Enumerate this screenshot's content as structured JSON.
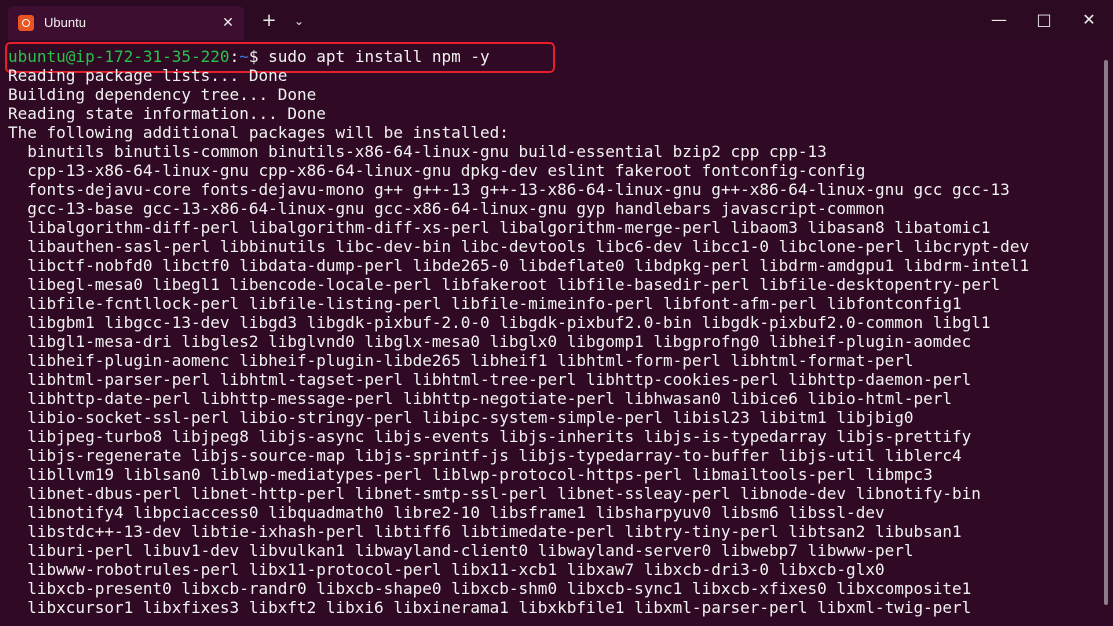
{
  "tab": {
    "title": "Ubuntu",
    "icon": "ubuntu-icon",
    "close_icon": "close-icon"
  },
  "titlebar": {
    "new_tab_icon": "plus-icon",
    "dropdown_icon": "chevron-down-icon",
    "minimize_icon": "minimize-icon",
    "maximize_icon": "maximize-icon",
    "close_icon": "close-icon"
  },
  "prompt": {
    "user_host": "ubuntu@ip-172-31-35-220",
    "separator": ":",
    "directory": "~",
    "symbol": "$",
    "command": " sudo apt install npm -y"
  },
  "output": [
    "Reading package lists... Done",
    "Building dependency tree... Done",
    "Reading state information... Done",
    "The following additional packages will be installed:",
    "  binutils binutils-common binutils-x86-64-linux-gnu build-essential bzip2 cpp cpp-13",
    "  cpp-13-x86-64-linux-gnu cpp-x86-64-linux-gnu dpkg-dev eslint fakeroot fontconfig-config",
    "  fonts-dejavu-core fonts-dejavu-mono g++ g++-13 g++-13-x86-64-linux-gnu g++-x86-64-linux-gnu gcc gcc-13",
    "  gcc-13-base gcc-13-x86-64-linux-gnu gcc-x86-64-linux-gnu gyp handlebars javascript-common",
    "  libalgorithm-diff-perl libalgorithm-diff-xs-perl libalgorithm-merge-perl libaom3 libasan8 libatomic1",
    "  libauthen-sasl-perl libbinutils libc-dev-bin libc-devtools libc6-dev libcc1-0 libclone-perl libcrypt-dev",
    "  libctf-nobfd0 libctf0 libdata-dump-perl libde265-0 libdeflate0 libdpkg-perl libdrm-amdgpu1 libdrm-intel1",
    "  libegl-mesa0 libegl1 libencode-locale-perl libfakeroot libfile-basedir-perl libfile-desktopentry-perl",
    "  libfile-fcntllock-perl libfile-listing-perl libfile-mimeinfo-perl libfont-afm-perl libfontconfig1",
    "  libgbm1 libgcc-13-dev libgd3 libgdk-pixbuf-2.0-0 libgdk-pixbuf2.0-bin libgdk-pixbuf2.0-common libgl1",
    "  libgl1-mesa-dri libgles2 libglvnd0 libglx-mesa0 libglx0 libgomp1 libgprofng0 libheif-plugin-aomdec",
    "  libheif-plugin-aomenc libheif-plugin-libde265 libheif1 libhtml-form-perl libhtml-format-perl",
    "  libhtml-parser-perl libhtml-tagset-perl libhtml-tree-perl libhttp-cookies-perl libhttp-daemon-perl",
    "  libhttp-date-perl libhttp-message-perl libhttp-negotiate-perl libhwasan0 libice6 libio-html-perl",
    "  libio-socket-ssl-perl libio-stringy-perl libipc-system-simple-perl libisl23 libitm1 libjbig0",
    "  libjpeg-turbo8 libjpeg8 libjs-async libjs-events libjs-inherits libjs-is-typedarray libjs-prettify",
    "  libjs-regenerate libjs-source-map libjs-sprintf-js libjs-typedarray-to-buffer libjs-util liblerc4",
    "  libllvm19 liblsan0 liblwp-mediatypes-perl liblwp-protocol-https-perl libmailtools-perl libmpc3",
    "  libnet-dbus-perl libnet-http-perl libnet-smtp-ssl-perl libnet-ssleay-perl libnode-dev libnotify-bin",
    "  libnotify4 libpciaccess0 libquadmath0 libre2-10 libsframe1 libsharpyuv0 libsm6 libssl-dev",
    "  libstdc++-13-dev libtie-ixhash-perl libtiff6 libtimedate-perl libtry-tiny-perl libtsan2 libubsan1",
    "  liburi-perl libuv1-dev libvulkan1 libwayland-client0 libwayland-server0 libwebp7 libwww-perl",
    "  libwww-robotrules-perl libx11-protocol-perl libx11-xcb1 libxaw7 libxcb-dri3-0 libxcb-glx0",
    "  libxcb-present0 libxcb-randr0 libxcb-shape0 libxcb-shm0 libxcb-sync1 libxcb-xfixes0 libxcomposite1",
    "  libxcursor1 libxfixes3 libxft2 libxi6 libxinerama1 libxkbfile1 libxml-parser-perl libxml-twig-perl"
  ],
  "colors": {
    "background": "#300a24",
    "text": "#f2f2f2",
    "user": "#27c24c",
    "directory": "#3c74d8",
    "highlight": "#e41f2a"
  }
}
